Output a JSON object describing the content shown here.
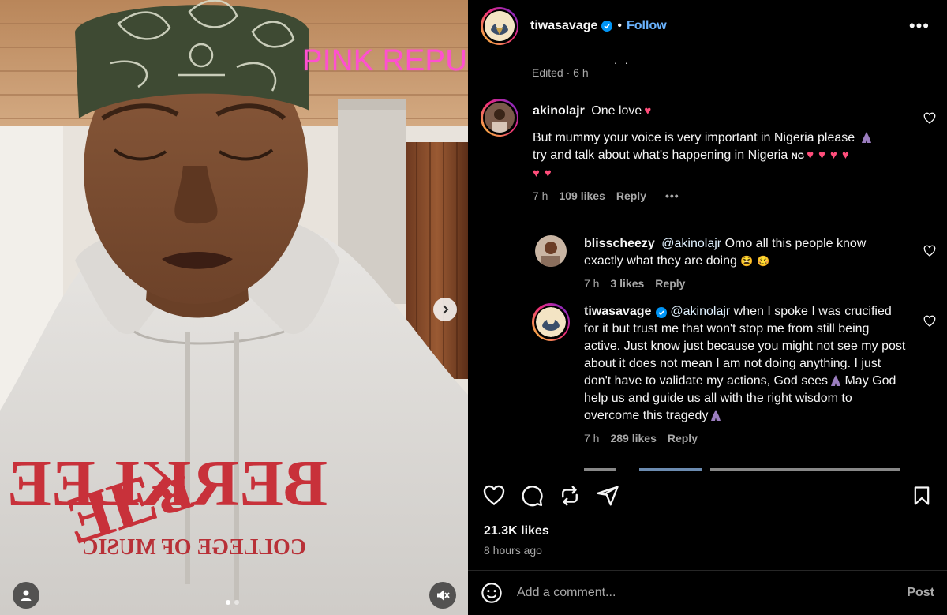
{
  "media": {
    "watermark": "PINK REPUBLIC TV",
    "hoodie_text_top": "BERKLEE",
    "hoodie_text_bottom": "COLLEGE OF MUSIC",
    "carousel_count": 2,
    "carousel_active": 0
  },
  "post": {
    "username": "tiwasavage",
    "follow_label": "Follow",
    "separator": "•",
    "more_label": "•••",
    "caption_partial": ". .",
    "caption_meta": "Edited · 6 h"
  },
  "comments": [
    {
      "username": "akinolajr",
      "line1": "One love",
      "text": "But mummy your voice is very important in Nigeria please",
      "text2": "try and talk about what's happening in Nigeria",
      "flag": "NG",
      "time": "7 h",
      "likes": "109 likes",
      "reply": "Reply",
      "more": "•••"
    },
    {
      "username": "blisscheezy",
      "mention": "@akinolajr",
      "text": "Omo all this people know exactly what they are doing",
      "time": "7 h",
      "likes": "3 likes",
      "reply": "Reply"
    },
    {
      "username": "tiwasavage",
      "mention": "@akinolajr",
      "text": "when I spoke I was crucified for it but trust me that won't stop me from still being active. Just know just because you might not see my post about it does not mean I am not doing anything. I just don't have to validate my actions, God sees",
      "text2": "May God help us and guide us all with the right wisdom to overcome this tragedy",
      "time": "7 h",
      "likes": "289 likes",
      "reply": "Reply"
    }
  ],
  "actions": {
    "likes": "21.3K likes",
    "time_ago": "8 hours ago"
  },
  "composer": {
    "placeholder": "Add a comment...",
    "post_label": "Post"
  },
  "colors": {
    "accent": "#0095f6",
    "follow": "#6bb4ff",
    "watermark": "#ff4fd0",
    "heart": "#ff4d7a",
    "muted": "#a8a8a8"
  }
}
